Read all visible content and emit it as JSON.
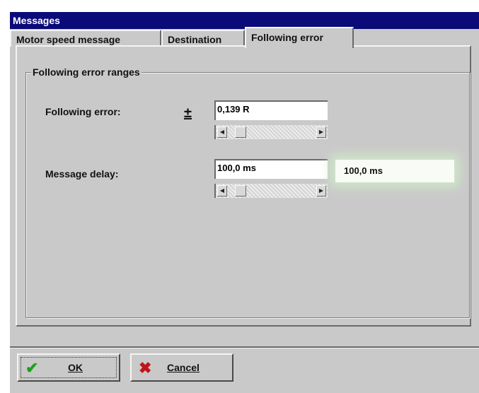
{
  "window": {
    "title": "Messages"
  },
  "tabs": [
    {
      "label": "Motor speed message"
    },
    {
      "label": "Destination"
    },
    {
      "label": "Following error"
    }
  ],
  "group": {
    "title": "Following error ranges"
  },
  "following_error": {
    "label": "Following error:",
    "plus_minus": "±",
    "value": "0,139  R",
    "slider_position": 0.1
  },
  "message_delay": {
    "label": "Message delay:",
    "value": "100,0 ms",
    "readout": "100,0 ms",
    "slider_position": 0.1
  },
  "buttons": {
    "ok": {
      "label": "OK",
      "icon": "check-icon"
    },
    "cancel": {
      "label": "Cancel",
      "icon": "x-icon"
    }
  },
  "colors": {
    "title_bar": "#0a0a78",
    "face": "#c9c9c9",
    "ok_check": "#19a319",
    "cancel_x": "#c0141a"
  }
}
